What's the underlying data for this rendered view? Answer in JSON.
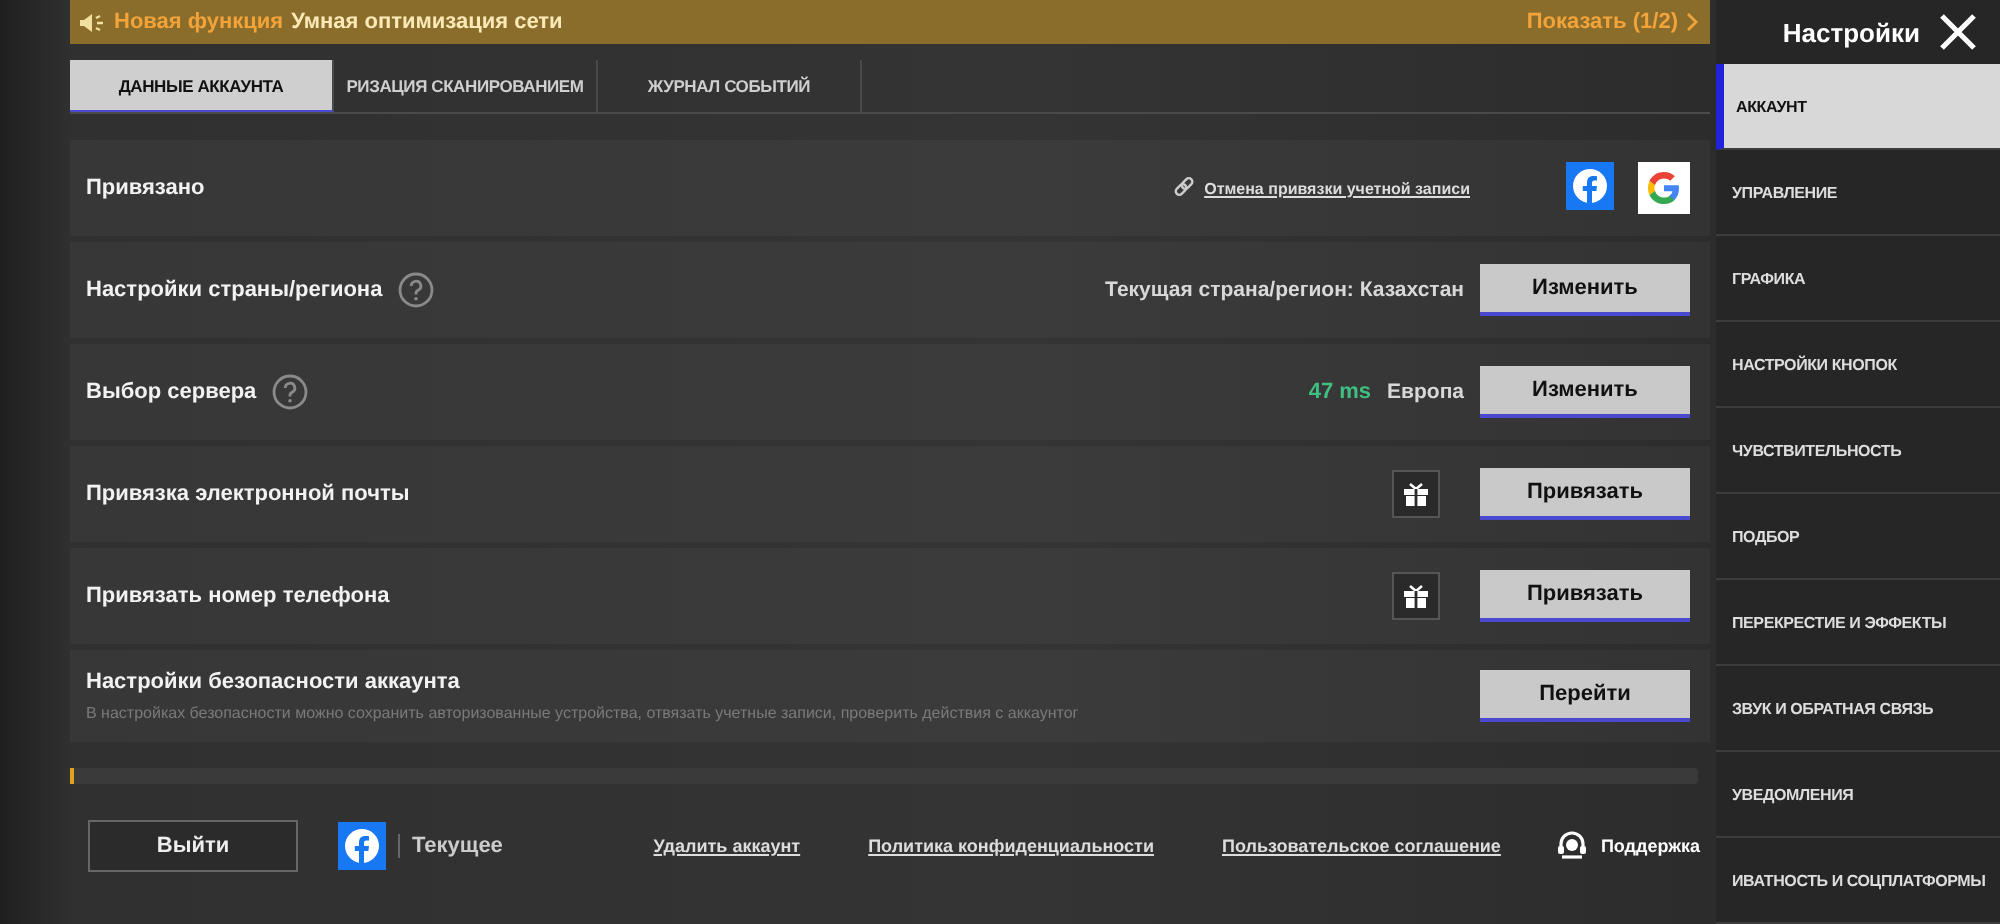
{
  "banner": {
    "tag": "Новая функция",
    "text": "Умная оптимизация сети",
    "action": "Показать (1/2)"
  },
  "tabs": [
    {
      "label": "ДАННЫЕ АККАУНТА",
      "selected": true
    },
    {
      "label": "РИЗАЦИЯ СКАНИРОВАНИЕМ",
      "selected": false
    },
    {
      "label": "ЖУРНАЛ СОБЫТИЙ",
      "selected": false
    }
  ],
  "rows": [
    {
      "kind": "linked",
      "label": "Привязано",
      "help": false,
      "link": "Отмена привязки учетной записи"
    },
    {
      "kind": "value",
      "label": "Настройки страны/региона",
      "help": true,
      "value": "Текущая страна/регион: Казахстан",
      "button": "Изменить"
    },
    {
      "kind": "ping",
      "label": "Выбор сервера",
      "help": true,
      "ping": "47 ms",
      "value": "Европа",
      "button": "Изменить"
    },
    {
      "kind": "gift",
      "label": "Привязка электронной почты",
      "help": false,
      "button": "Привязать"
    },
    {
      "kind": "gift",
      "label": "Привязать номер телефона",
      "help": false,
      "button": "Привязать"
    },
    {
      "kind": "description",
      "label": "Настройки безопасности аккаунта",
      "help": false,
      "description": "В настройках безопасности можно сохранить авторизованные устройства, отвязать учетные записи, проверить действия с аккаунтог",
      "button": "Перейти"
    }
  ],
  "footer": {
    "logout": "Выйти",
    "current": "Текущее",
    "links": [
      "Удалить аккаунт",
      "Политика конфиденциальности",
      "Пользовательское соглашение"
    ],
    "support": "Поддержка"
  },
  "sidebar": {
    "title": "Настройки",
    "items": [
      {
        "label": "АККАУНТ",
        "selected": true
      },
      {
        "label": "УПРАВЛЕНИЕ",
        "selected": false
      },
      {
        "label": "ГРАФИКА",
        "selected": false
      },
      {
        "label": "НАСТРОЙКИ КНОПОК",
        "selected": false
      },
      {
        "label": "ЧУВСТВИТЕЛЬНОСТЬ",
        "selected": false
      },
      {
        "label": "ПОДБОР",
        "selected": false
      },
      {
        "label": "ПЕРЕКРЕСТИЕ И ЭФФЕКТЫ",
        "selected": false
      },
      {
        "label": "ЗВУК И ОБРАТНАЯ СВЯЗЬ",
        "selected": false
      },
      {
        "label": "УВЕДОМЛЕНИЯ",
        "selected": false
      },
      {
        "label": "ИВАТНОСТЬ И СОЦПЛАТФОРМЫ",
        "selected": false
      }
    ]
  }
}
